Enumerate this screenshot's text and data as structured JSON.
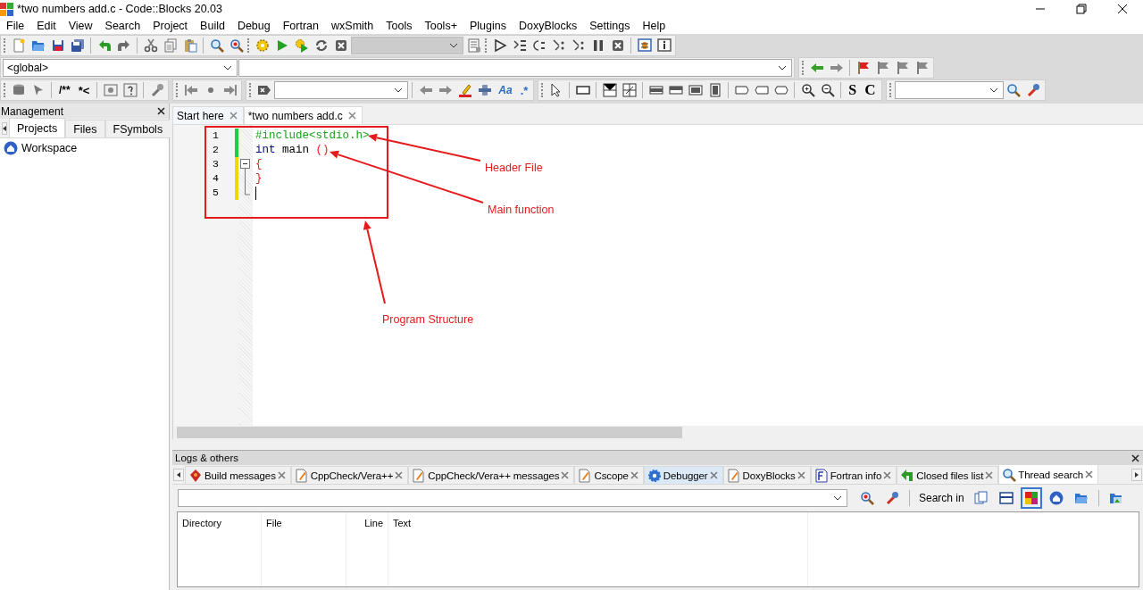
{
  "window": {
    "title": "*two numbers add.c - Code::Blocks 20.03"
  },
  "menu": [
    "File",
    "Edit",
    "View",
    "Search",
    "Project",
    "Build",
    "Debug",
    "Fortran",
    "wxSmith",
    "Tools",
    "Tools+",
    "Plugins",
    "DoxyBlocks",
    "Settings",
    "Help"
  ],
  "toolbar": {
    "scope": "<global>",
    "text_buttons": [
      "/**",
      "*<",
      "Aa",
      ".*",
      "S",
      "C"
    ]
  },
  "management": {
    "title": "Management",
    "tabs": [
      {
        "label": "Projects",
        "selected": true
      },
      {
        "label": "Files",
        "selected": false
      },
      {
        "label": "FSymbols",
        "selected": false
      }
    ],
    "tree": [
      {
        "label": "Workspace"
      }
    ]
  },
  "editor": {
    "tabs": [
      {
        "label": "Start here",
        "selected": false
      },
      {
        "label": "*two numbers add.c",
        "selected": true
      }
    ],
    "lines": [
      {
        "number": "1",
        "modified": false,
        "kind": "plain",
        "cursor": false,
        "tokens": [
          {
            "text": "#include<stdio.h>",
            "kind": "preprocessor"
          }
        ]
      },
      {
        "number": "2",
        "modified": false,
        "kind": "plain",
        "cursor": false,
        "tokens": [
          {
            "text": "int",
            "kind": "keyword"
          },
          {
            "text": " main ",
            "kind": "plain"
          },
          {
            "text": "()",
            "kind": "brace"
          }
        ]
      },
      {
        "number": "3",
        "modified": true,
        "kind": "open",
        "cursor": false,
        "tokens": [
          {
            "text": "{",
            "kind": "brace"
          }
        ]
      },
      {
        "number": "4",
        "modified": true,
        "kind": "inner",
        "cursor": false,
        "tokens": [
          {
            "text": "}",
            "kind": "brace"
          }
        ]
      },
      {
        "number": "5",
        "modified": true,
        "kind": "close",
        "cursor": true
      }
    ]
  },
  "annotations": [
    {
      "label": "Header File"
    },
    {
      "label": "Main function"
    },
    {
      "label": "Program Structure"
    }
  ],
  "logs": {
    "title": "Logs & others",
    "tabs": [
      {
        "label": "Build messages",
        "selected": false,
        "highlighted": false
      },
      {
        "label": "CppCheck/Vera++",
        "selected": false,
        "highlighted": false
      },
      {
        "label": "CppCheck/Vera++ messages",
        "selected": false,
        "highlighted": false
      },
      {
        "label": "Cscope",
        "selected": false,
        "highlighted": false
      },
      {
        "label": "Debugger",
        "selected": false,
        "highlighted": true
      },
      {
        "label": "DoxyBlocks",
        "selected": false,
        "highlighted": false
      },
      {
        "label": "Fortran info",
        "selected": false,
        "highlighted": false
      },
      {
        "label": "Closed files list",
        "selected": false,
        "highlighted": false
      },
      {
        "label": "Thread search",
        "selected": true,
        "highlighted": false
      }
    ],
    "search_in": "Search in",
    "scopes": [
      {
        "selected": false
      },
      {
        "selected": false
      },
      {
        "selected": true
      },
      {
        "selected": false
      },
      {
        "selected": false
      }
    ],
    "columns": [
      {
        "label": "Directory",
        "kind": "text"
      },
      {
        "label": "File",
        "kind": "text"
      },
      {
        "label": "Line",
        "kind": "numeric"
      },
      {
        "label": "Text",
        "kind": "text"
      }
    ]
  }
}
